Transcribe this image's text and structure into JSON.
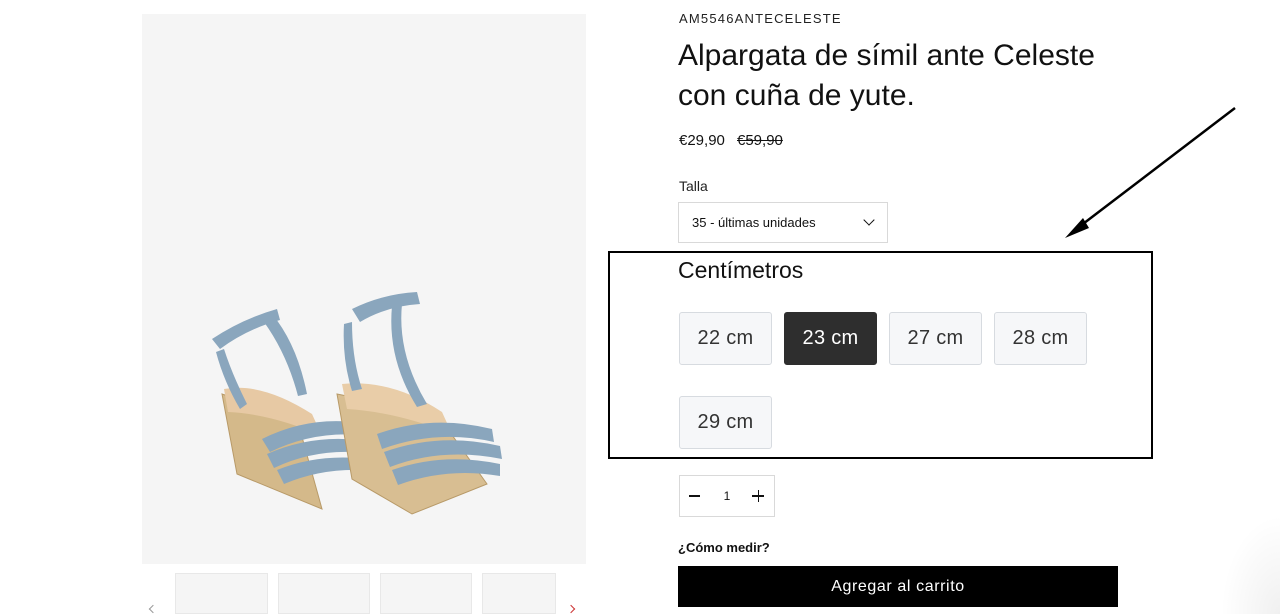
{
  "product": {
    "sku": "AM5546ANTECELESTE",
    "title": "Alpargata de símil ante Celeste con cuña de yute.",
    "price": "€29,90",
    "price_old": "€59,90"
  },
  "size": {
    "label": "Talla",
    "selected": "35 - últimas unidades"
  },
  "centimeters": {
    "title": "Centímetros",
    "options": [
      {
        "label": "22 cm",
        "selected": false
      },
      {
        "label": "23 cm",
        "selected": true
      },
      {
        "label": "27 cm",
        "selected": false
      },
      {
        "label": "28 cm",
        "selected": false
      },
      {
        "label": "29 cm",
        "selected": false
      }
    ]
  },
  "quantity": {
    "value": "1"
  },
  "how_to_measure": "¿Cómo medir?",
  "add_to_cart_label": "Agregar al carrito",
  "colors": {
    "selected_option_bg": "#2e2e2e",
    "button_bg": "#000000",
    "image_bg": "#f5f5f5",
    "sandal_strap": "#8aa6bd"
  },
  "icons": {
    "select": "chevron-down-icon",
    "minus": "minus-icon",
    "plus": "plus-icon",
    "annotation": "arrow-icon"
  }
}
